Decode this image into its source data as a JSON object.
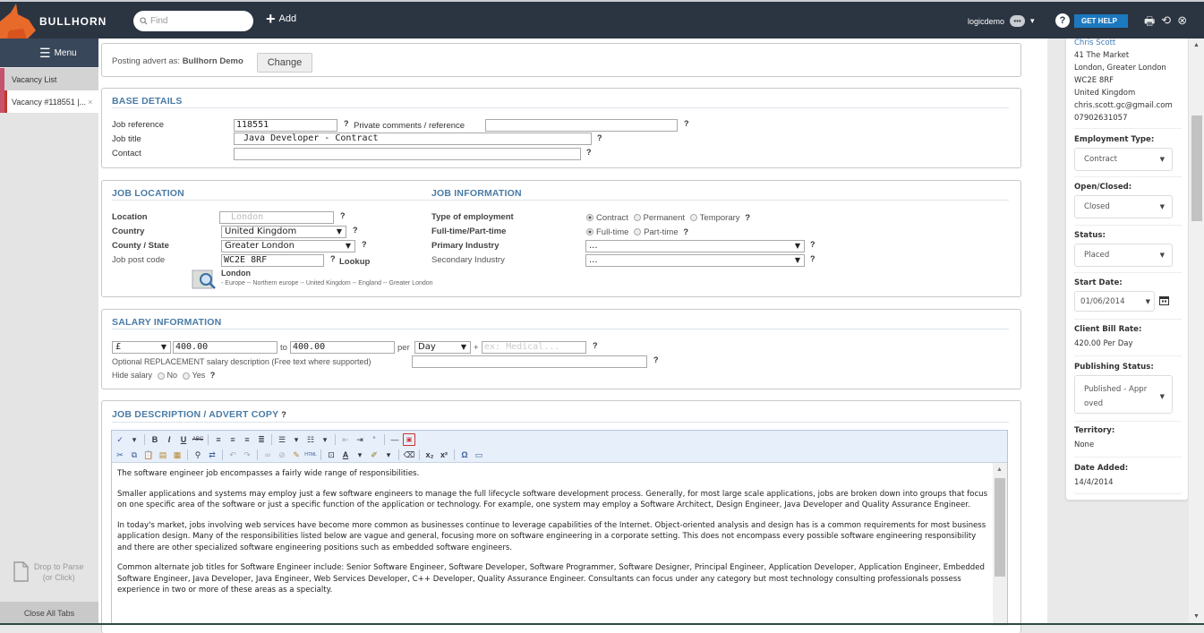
{
  "topbar": {
    "brand": "BULLHORN",
    "search_placeholder": "Find",
    "add_label": "Add",
    "username": "logicdemo",
    "help_label": "GET HELP"
  },
  "sidebar": {
    "menu_label": "Menu",
    "tabs": [
      {
        "label": "Vacancy List"
      },
      {
        "label": "Vacancy #118551 |...",
        "close": "×"
      }
    ],
    "drop_to_parse": "Drop to Parse",
    "drop_hint": "(or Click)",
    "close_all": "Close All Tabs"
  },
  "posting": {
    "label": "Posting advert as:",
    "account": "Bullhorn Demo",
    "change_label": "Change"
  },
  "base_details": {
    "title": "BASE DETAILS",
    "job_reference_label": "Job reference",
    "job_reference": "118551",
    "private_comments_label": "Private comments / reference",
    "private_comments": "",
    "job_title_label": "Job title",
    "job_title": "Java Developer - Contract",
    "contact_label": "Contact",
    "contact": ""
  },
  "job_location": {
    "title": "JOB LOCATION",
    "location_label": "Location",
    "location_placeholder": "London",
    "country_label": "Country",
    "country": "United Kingdom",
    "county_label": "County / State",
    "county": "Greater London",
    "postcode_label": "Job post code",
    "postcode": "WC2E 8RF",
    "lookup_label": "Lookup",
    "resolved_city": "London",
    "resolved_path": "- Europe -- Northern europe -- United Kingdom -- England -- Greater London"
  },
  "job_information": {
    "title": "JOB INFORMATION",
    "employment_type_label": "Type of employment",
    "employment_options": [
      "Contract",
      "Permanent",
      "Temporary"
    ],
    "employment_selected": "Contract",
    "fulltime_label": "Full-time/Part-time",
    "fulltime_options": [
      "Full-time",
      "Part-time"
    ],
    "fulltime_selected": "Full-time",
    "primary_industry_label": "Primary Industry",
    "primary_industry": "...",
    "secondary_industry_label": "Secondary Industry",
    "secondary_industry": "..."
  },
  "salary": {
    "title": "SALARY INFORMATION",
    "currency": "£",
    "from": "400.00",
    "to_label": "to",
    "to": "400.00",
    "per_label": "per",
    "period": "Day",
    "plus": "+",
    "benefits_placeholder": "ex: Medical...",
    "replacement_label": "Optional REPLACEMENT salary description (Free text where supported)",
    "replacement_value": "",
    "hide_label": "Hide salary",
    "hide_options": [
      "No",
      "Yes"
    ]
  },
  "description": {
    "title": "JOB DESCRIPTION / ADVERT COPY",
    "paragraphs": [
      "The software engineer job encompasses a fairly wide range of responsibilities.",
      "Smaller applications and systems may employ just a few software engineers to manage the full lifecycle software development process. Generally, for most large scale applications, jobs are broken down into groups that focus on one specific area of the software or just a specific function of the application or technology. For example, one system may employ a Software Architect, Design Engineer, Java Developer and Quality Assurance Engineer.",
      "In today's market, jobs involving web services have become more common as businesses continue to leverage capabilities of the Internet. Object-oriented analysis and design has is a common requirements for most business application design. Many of the responsibilities listed below are vague and general, focusing more on software engineering in a corporate setting. This does not encompass every possible software engineering responsibility and there are other specialized software engineering positions such as embedded software engineers.",
      "Common alternate job titles for Software Engineer include: Senior Software Engineer, Software Developer, Software Programmer, Software Designer, Principal Engineer, Application Developer, Application Engineer, Embedded Software Engineer, Java Developer, Java Engineer, Web Services Developer, C++ Developer, Quality Assurance Engineer. Consultants can focus under any category but most technology consulting professionals possess experience in two or more of these areas as a specialty."
    ]
  },
  "right_panel": {
    "contact_name": "Chris Scott",
    "address_lines": [
      "41 The Market",
      "London, Greater London",
      "WC2E 8RF",
      "United Kingdom"
    ],
    "email": "chris.scott.gc@gmail.com",
    "phone": "07902631057",
    "employment_type_label": "Employment Type:",
    "employment_type": "Contract",
    "open_closed_label": "Open/Closed:",
    "open_closed": "Closed",
    "status_label": "Status:",
    "status": "Placed",
    "start_date_label": "Start Date:",
    "start_date": "01/06/2014",
    "bill_rate_label": "Client Bill Rate:",
    "bill_rate": "420.00 Per Day",
    "publishing_label": "Publishing Status:",
    "publishing_line1": "Published - Appr",
    "publishing_line2": "oved",
    "territory_label": "Territory:",
    "territory": "None",
    "date_added_label": "Date Added:",
    "date_added": "14/4/2014"
  },
  "colors": {
    "topbar": "#2b3441",
    "accent_blue": "#4a7ba6",
    "help_button": "#1c79c0",
    "active_tab_marker": "#c0392b"
  }
}
